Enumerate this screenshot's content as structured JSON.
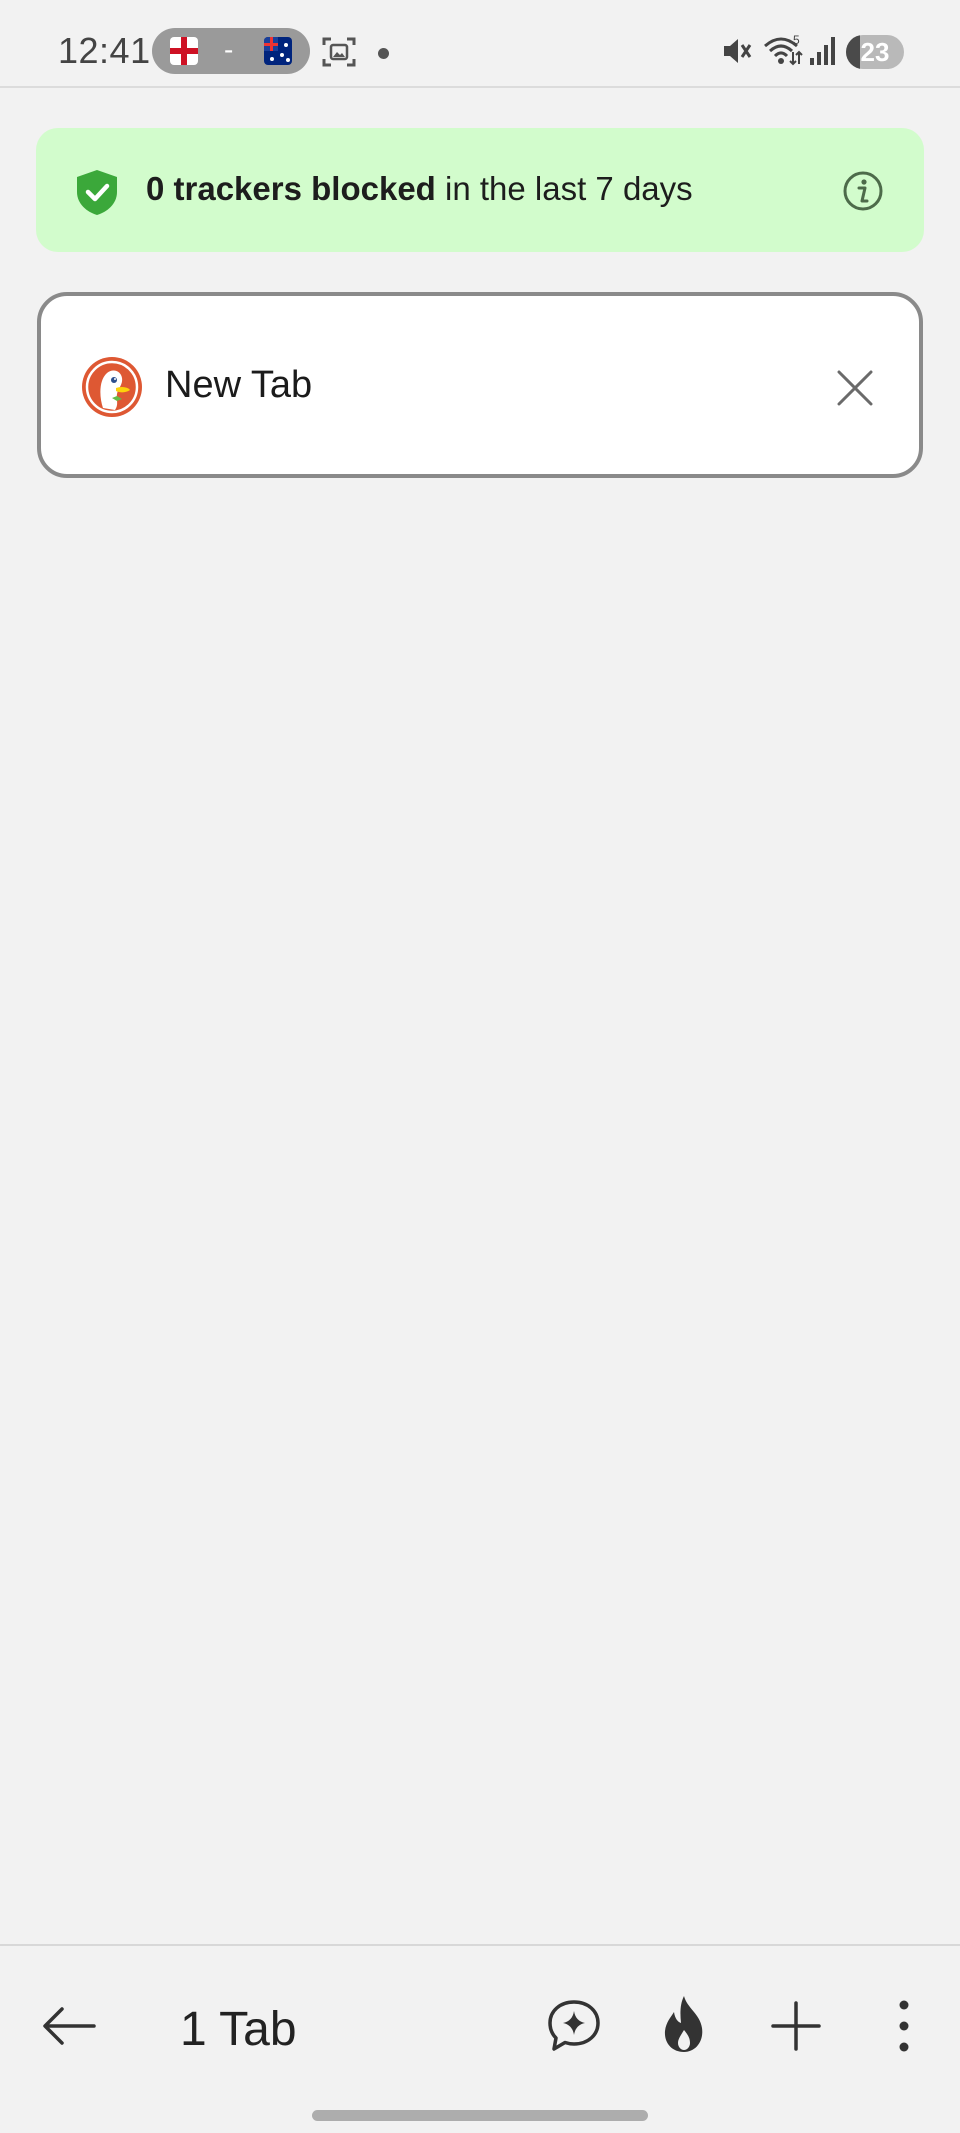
{
  "status_bar": {
    "time": "12:41",
    "flag_separator": "-",
    "battery_level": "23"
  },
  "tracker_banner": {
    "count_text": "0 trackers blocked",
    "suffix_text": " in the last 7 days",
    "accent_color": "#d2fccc",
    "icon_name": "shield-check-icon"
  },
  "tabs": [
    {
      "title": "New Tab",
      "favicon": "duckduckgo-logo-icon"
    }
  ],
  "bottom_bar": {
    "tab_count_label": "1 Tab",
    "icons": [
      "back-arrow-icon",
      "ai-chat-icon",
      "fire-icon",
      "plus-icon",
      "more-vertical-icon"
    ]
  }
}
